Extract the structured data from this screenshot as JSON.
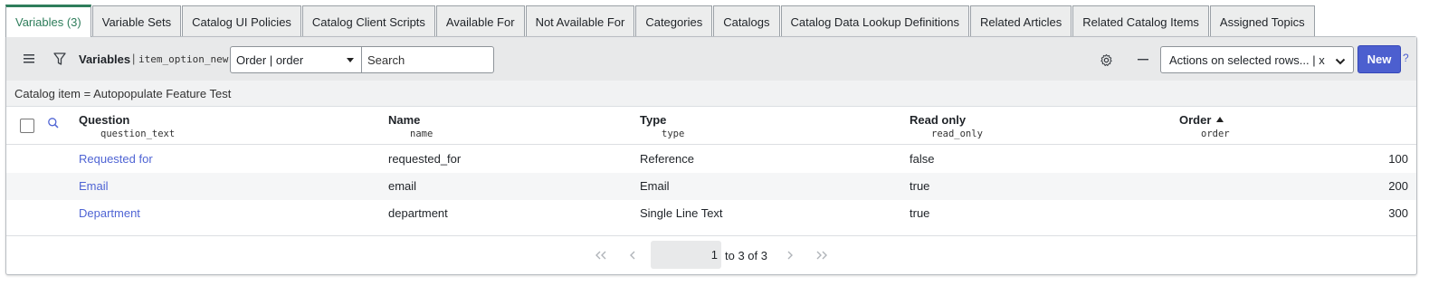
{
  "tabs": [
    {
      "label": "Variables (3)",
      "active": true
    },
    {
      "label": "Variable Sets"
    },
    {
      "label": "Catalog UI Policies"
    },
    {
      "label": "Catalog Client Scripts"
    },
    {
      "label": "Available For"
    },
    {
      "label": "Not Available For"
    },
    {
      "label": "Categories"
    },
    {
      "label": "Catalogs"
    },
    {
      "label": "Catalog Data Lookup Definitions"
    },
    {
      "label": "Related Articles"
    },
    {
      "label": "Related Catalog Items"
    },
    {
      "label": "Assigned Topics"
    }
  ],
  "toolbar": {
    "list_title": "Variables",
    "separator": "|",
    "table_name": "item_option_new",
    "field_select": "Order | order",
    "search_placeholder": "Search",
    "actions_select": "Actions on selected rows... | x",
    "new_label": "New",
    "help": "?"
  },
  "breadcrumb": "Catalog item = Autopopulate Feature Test",
  "columns": [
    {
      "label": "Question",
      "field": "question_text"
    },
    {
      "label": "Name",
      "field": "name"
    },
    {
      "label": "Type",
      "field": "type"
    },
    {
      "label": "Read only",
      "field": "read_only"
    },
    {
      "label": "Order",
      "field": "order",
      "sorted": "ascending"
    }
  ],
  "rows": [
    {
      "question": "Requested for",
      "name": "requested_for",
      "type": "Reference",
      "read_only": "false",
      "order": "100"
    },
    {
      "question": "Email",
      "name": "email",
      "type": "Email",
      "read_only": "true",
      "order": "200"
    },
    {
      "question": "Department",
      "name": "department",
      "type": "Single Line Text",
      "read_only": "true",
      "order": "300"
    }
  ],
  "pagination": {
    "current": "1",
    "summary": "to 3 of 3"
  },
  "colors": {
    "accent": "#2e7d5b",
    "link": "#4f64d4",
    "primary_button": "#4c5fcf"
  },
  "icons": [
    "menu-icon",
    "filter-icon",
    "gear-icon",
    "minus-icon",
    "search-icon",
    "chevron-down-icon",
    "first-page-icon",
    "previous-page-icon",
    "next-page-icon",
    "last-page-icon",
    "sort-ascending-icon"
  ]
}
